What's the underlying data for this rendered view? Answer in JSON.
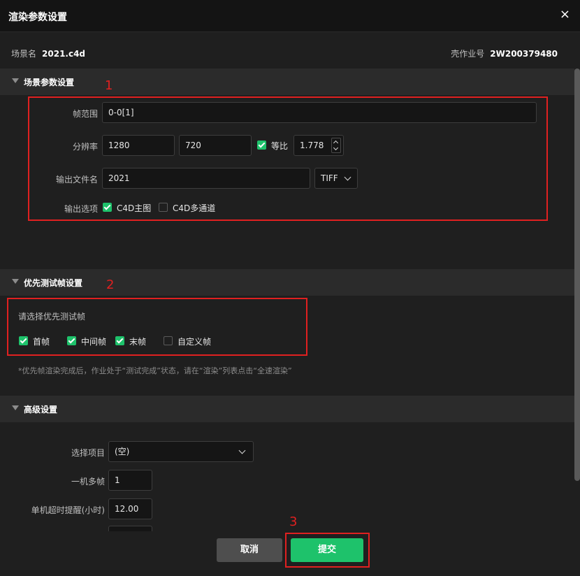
{
  "dialog": {
    "title": "渲染参数设置",
    "close": "×"
  },
  "scene": {
    "name_label": "场景名",
    "name_value": "2021.c4d",
    "job_label": "壳作业号",
    "job_value": "2W200379480"
  },
  "section1": {
    "title": "场景参数设置",
    "frame_range": {
      "label": "帧范围",
      "value": "0-0[1]"
    },
    "resolution": {
      "label": "分辨率",
      "width": "1280",
      "height": "720",
      "ratio_label": "等比",
      "ratio_checked": true,
      "ratio_value": "1.778"
    },
    "output_name": {
      "label": "输出文件名",
      "value": "2021",
      "format": "TIFF"
    },
    "output_options": {
      "label": "输出选项",
      "opt1": "C4D主图",
      "opt1_checked": true,
      "opt2": "C4D多通道",
      "opt2_checked": false
    }
  },
  "section2": {
    "title": "优先测试帧设置",
    "prompt": "请选择优先测试帧",
    "options": [
      {
        "label": "首帧",
        "checked": true
      },
      {
        "label": "中间帧",
        "checked": true
      },
      {
        "label": "末帧",
        "checked": true
      },
      {
        "label": "自定义帧",
        "checked": false
      }
    ],
    "note": "*优先帧渲染完成后，作业处于“测试完成”状态，请在“渲染”列表点击“全速渲染”"
  },
  "section3": {
    "title": "高级设置",
    "project": {
      "label": "选择项目",
      "value": "(空)"
    },
    "multi_frame": {
      "label": "一机多帧",
      "value": "1"
    },
    "timeout": {
      "label": "单机超时提醒(小时)",
      "value": "12.00"
    }
  },
  "annotations": [
    "1",
    "2",
    "3"
  ],
  "footer": {
    "cancel": "取消",
    "submit": "提交"
  },
  "colors": {
    "accent": "#1ec26b",
    "annotation": "#e02020",
    "background": "#1f1f1f"
  }
}
